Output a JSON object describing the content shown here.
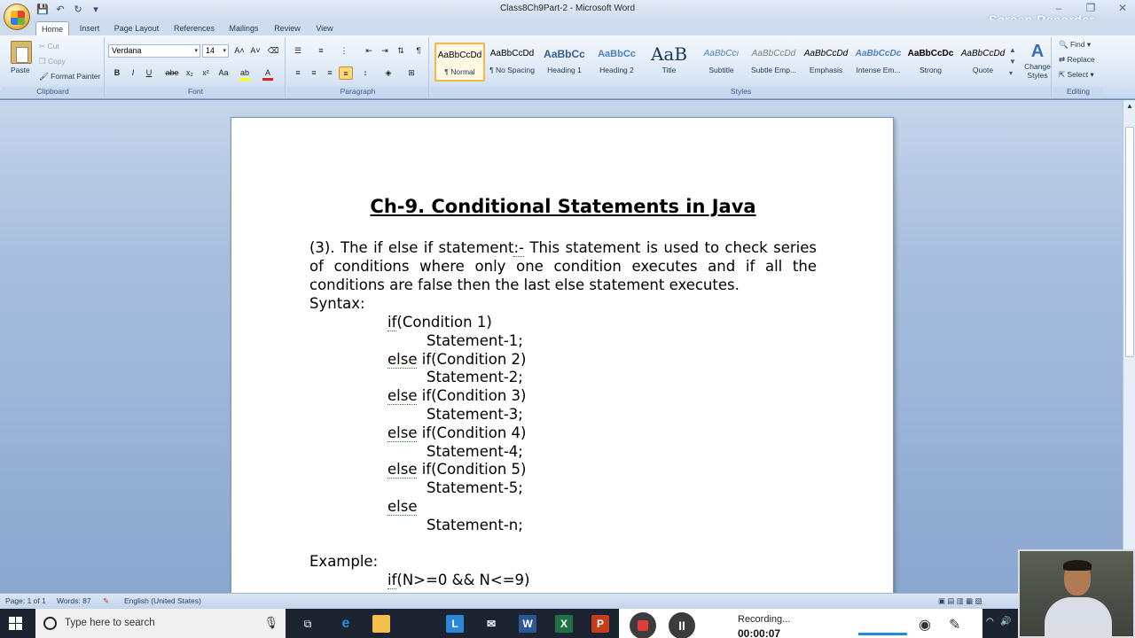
{
  "window": {
    "title": "Class8Ch9Part-2 - Microsoft Word",
    "recorder_badge": "Screen Recorder"
  },
  "quick_access": [
    "save",
    "undo",
    "redo",
    "customize"
  ],
  "tabs": [
    "Home",
    "Insert",
    "Page Layout",
    "References",
    "Mailings",
    "Review",
    "View"
  ],
  "active_tab": "Home",
  "clipboard": {
    "paste": "Paste",
    "cut": "Cut",
    "copy": "Copy",
    "format_painter": "Format Painter",
    "label": "Clipboard"
  },
  "font": {
    "name": "Verdana",
    "size": "14",
    "label": "Font",
    "buttons": [
      "B",
      "I",
      "U",
      "abe",
      "x₂",
      "x²",
      "Aa"
    ]
  },
  "paragraph": {
    "label": "Paragraph"
  },
  "styles": {
    "label": "Styles",
    "items": [
      {
        "sample": "AaBbCcDd",
        "name": "¶ Normal",
        "selected": true
      },
      {
        "sample": "AaBbCcDd",
        "name": "¶ No Spacing",
        "selected": false
      },
      {
        "sample": "AaBbCc",
        "name": "Heading 1",
        "selected": false
      },
      {
        "sample": "AaBbCc",
        "name": "Heading 2",
        "selected": false
      },
      {
        "sample": "AaB",
        "name": "Title",
        "selected": false
      },
      {
        "sample": "AaBbCcı",
        "name": "Subtitle",
        "selected": false
      },
      {
        "sample": "AaBbCcDd",
        "name": "Subtle Emp...",
        "selected": false
      },
      {
        "sample": "AaBbCcDd",
        "name": "Emphasis",
        "selected": false
      },
      {
        "sample": "AaBbCcDc",
        "name": "Intense Em...",
        "selected": false
      },
      {
        "sample": "AaBbCcDc",
        "name": "Strong",
        "selected": false
      },
      {
        "sample": "AaBbCcDd",
        "name": "Quote",
        "selected": false
      }
    ],
    "change_styles_line1": "Change",
    "change_styles_line2": "Styles"
  },
  "editing": {
    "find": "Find",
    "replace": "Replace",
    "select": "Select",
    "label": "Editing"
  },
  "document": {
    "title": "Ch-9. Conditional Statements in Java",
    "intro_prefix": "(3). The if else if statement",
    "intro_colon": ":-",
    "intro_rest": " This statement is used to check series of conditions where only one condition executes and if all the conditions are false then the last else statement executes.",
    "syntax_label": "Syntax:",
    "syntax": [
      {
        "kw": "if",
        "text": "(Condition 1)",
        "indent": 1
      },
      {
        "kw": "",
        "text": "Statement-1;",
        "indent": 2
      },
      {
        "kw": "else",
        "text": " if(Condition 2)",
        "indent": 1
      },
      {
        "kw": "",
        "text": "Statement-2;",
        "indent": 2
      },
      {
        "kw": "else",
        "text": " if(Condition 3)",
        "indent": 1
      },
      {
        "kw": "",
        "text": "Statement-3;",
        "indent": 2
      },
      {
        "kw": "else",
        "text": " if(Condition 4)",
        "indent": 1
      },
      {
        "kw": "",
        "text": "Statement-4;",
        "indent": 2
      },
      {
        "kw": "else",
        "text": " if(Condition 5)",
        "indent": 1
      },
      {
        "kw": "",
        "text": "Statement-5;",
        "indent": 2
      },
      {
        "kw": "else",
        "text": "",
        "indent": 1
      },
      {
        "kw": "",
        "text": "Statement-n;",
        "indent": 2
      }
    ],
    "example_label": "Example:",
    "example_line": {
      "kw": "if",
      "text": "(N>=0 && N<=9)"
    }
  },
  "status": {
    "page": "Page: 1 of 1",
    "words": "Words: 87",
    "language": "English (United States)"
  },
  "taskbar": {
    "search_placeholder": "Type here to search",
    "apps": [
      "task-view",
      "edge",
      "file-explorer",
      "launcher",
      "mail",
      "word",
      "excel",
      "powerpoint"
    ]
  },
  "recorder": {
    "status": "Recording...",
    "time": "00:00:07"
  }
}
